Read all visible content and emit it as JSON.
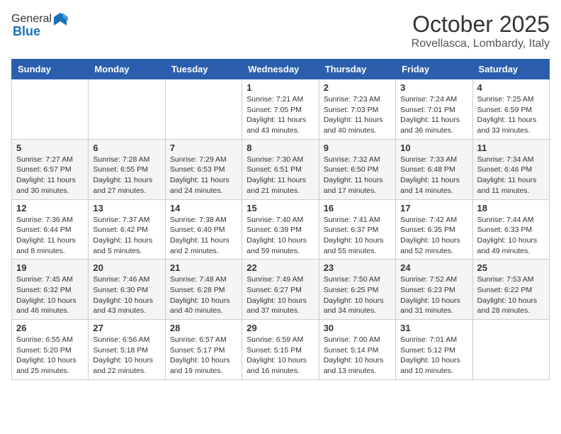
{
  "header": {
    "logo_general": "General",
    "logo_blue": "Blue",
    "month_title": "October 2025",
    "location": "Rovellasca, Lombardy, Italy"
  },
  "days_of_week": [
    "Sunday",
    "Monday",
    "Tuesday",
    "Wednesday",
    "Thursday",
    "Friday",
    "Saturday"
  ],
  "weeks": [
    {
      "days": [
        {
          "num": "",
          "info": ""
        },
        {
          "num": "",
          "info": ""
        },
        {
          "num": "",
          "info": ""
        },
        {
          "num": "1",
          "info": "Sunrise: 7:21 AM\nSunset: 7:05 PM\nDaylight: 11 hours\nand 43 minutes."
        },
        {
          "num": "2",
          "info": "Sunrise: 7:23 AM\nSunset: 7:03 PM\nDaylight: 11 hours\nand 40 minutes."
        },
        {
          "num": "3",
          "info": "Sunrise: 7:24 AM\nSunset: 7:01 PM\nDaylight: 11 hours\nand 36 minutes."
        },
        {
          "num": "4",
          "info": "Sunrise: 7:25 AM\nSunset: 6:59 PM\nDaylight: 11 hours\nand 33 minutes."
        }
      ]
    },
    {
      "days": [
        {
          "num": "5",
          "info": "Sunrise: 7:27 AM\nSunset: 6:57 PM\nDaylight: 11 hours\nand 30 minutes."
        },
        {
          "num": "6",
          "info": "Sunrise: 7:28 AM\nSunset: 6:55 PM\nDaylight: 11 hours\nand 27 minutes."
        },
        {
          "num": "7",
          "info": "Sunrise: 7:29 AM\nSunset: 6:53 PM\nDaylight: 11 hours\nand 24 minutes."
        },
        {
          "num": "8",
          "info": "Sunrise: 7:30 AM\nSunset: 6:51 PM\nDaylight: 11 hours\nand 21 minutes."
        },
        {
          "num": "9",
          "info": "Sunrise: 7:32 AM\nSunset: 6:50 PM\nDaylight: 11 hours\nand 17 minutes."
        },
        {
          "num": "10",
          "info": "Sunrise: 7:33 AM\nSunset: 6:48 PM\nDaylight: 11 hours\nand 14 minutes."
        },
        {
          "num": "11",
          "info": "Sunrise: 7:34 AM\nSunset: 6:46 PM\nDaylight: 11 hours\nand 11 minutes."
        }
      ]
    },
    {
      "days": [
        {
          "num": "12",
          "info": "Sunrise: 7:36 AM\nSunset: 6:44 PM\nDaylight: 11 hours\nand 8 minutes."
        },
        {
          "num": "13",
          "info": "Sunrise: 7:37 AM\nSunset: 6:42 PM\nDaylight: 11 hours\nand 5 minutes."
        },
        {
          "num": "14",
          "info": "Sunrise: 7:38 AM\nSunset: 6:40 PM\nDaylight: 11 hours\nand 2 minutes."
        },
        {
          "num": "15",
          "info": "Sunrise: 7:40 AM\nSunset: 6:39 PM\nDaylight: 10 hours\nand 59 minutes."
        },
        {
          "num": "16",
          "info": "Sunrise: 7:41 AM\nSunset: 6:37 PM\nDaylight: 10 hours\nand 55 minutes."
        },
        {
          "num": "17",
          "info": "Sunrise: 7:42 AM\nSunset: 6:35 PM\nDaylight: 10 hours\nand 52 minutes."
        },
        {
          "num": "18",
          "info": "Sunrise: 7:44 AM\nSunset: 6:33 PM\nDaylight: 10 hours\nand 49 minutes."
        }
      ]
    },
    {
      "days": [
        {
          "num": "19",
          "info": "Sunrise: 7:45 AM\nSunset: 6:32 PM\nDaylight: 10 hours\nand 46 minutes."
        },
        {
          "num": "20",
          "info": "Sunrise: 7:46 AM\nSunset: 6:30 PM\nDaylight: 10 hours\nand 43 minutes."
        },
        {
          "num": "21",
          "info": "Sunrise: 7:48 AM\nSunset: 6:28 PM\nDaylight: 10 hours\nand 40 minutes."
        },
        {
          "num": "22",
          "info": "Sunrise: 7:49 AM\nSunset: 6:27 PM\nDaylight: 10 hours\nand 37 minutes."
        },
        {
          "num": "23",
          "info": "Sunrise: 7:50 AM\nSunset: 6:25 PM\nDaylight: 10 hours\nand 34 minutes."
        },
        {
          "num": "24",
          "info": "Sunrise: 7:52 AM\nSunset: 6:23 PM\nDaylight: 10 hours\nand 31 minutes."
        },
        {
          "num": "25",
          "info": "Sunrise: 7:53 AM\nSunset: 6:22 PM\nDaylight: 10 hours\nand 28 minutes."
        }
      ]
    },
    {
      "days": [
        {
          "num": "26",
          "info": "Sunrise: 6:55 AM\nSunset: 5:20 PM\nDaylight: 10 hours\nand 25 minutes."
        },
        {
          "num": "27",
          "info": "Sunrise: 6:56 AM\nSunset: 5:18 PM\nDaylight: 10 hours\nand 22 minutes."
        },
        {
          "num": "28",
          "info": "Sunrise: 6:57 AM\nSunset: 5:17 PM\nDaylight: 10 hours\nand 19 minutes."
        },
        {
          "num": "29",
          "info": "Sunrise: 6:59 AM\nSunset: 5:15 PM\nDaylight: 10 hours\nand 16 minutes."
        },
        {
          "num": "30",
          "info": "Sunrise: 7:00 AM\nSunset: 5:14 PM\nDaylight: 10 hours\nand 13 minutes."
        },
        {
          "num": "31",
          "info": "Sunrise: 7:01 AM\nSunset: 5:12 PM\nDaylight: 10 hours\nand 10 minutes."
        },
        {
          "num": "",
          "info": ""
        }
      ]
    }
  ]
}
